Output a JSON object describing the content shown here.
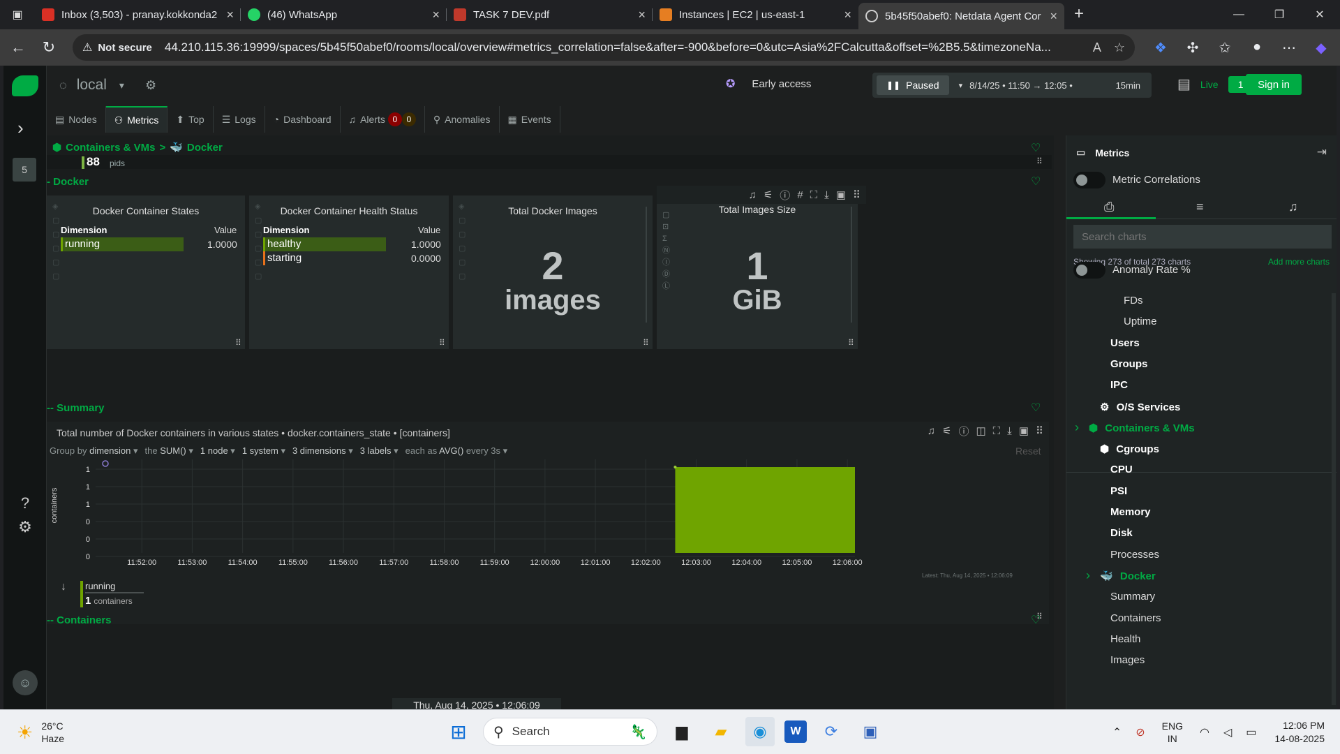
{
  "browser": {
    "tabs": [
      {
        "title": "Inbox (3,503) - pranay.kokkonda2",
        "color": "#d93025"
      },
      {
        "title": "(46) WhatsApp",
        "color": "#25d366"
      },
      {
        "title": "TASK 7 DEV.pdf",
        "color": "#c0392b"
      },
      {
        "title": "Instances | EC2 | us-east-1",
        "color": "#e67e22"
      },
      {
        "title": "5b45f50abef0: Netdata Agent Cor",
        "color": "#cfcfcf"
      }
    ],
    "not_secure": "Not secure",
    "url": "44.210.115.36:19999/spaces/5b45f50abef0/rooms/local/overview#metrics_correlation=false&after=-900&before=0&utc=Asia%2FCalcutta&offset=%2B5.5&timezoneNa..."
  },
  "netdata": {
    "room_name": "local",
    "space_badge": "5",
    "early_access": "Early access",
    "paused_label": "Paused",
    "time_range": "8/14/25 • 11:50 → 12:05 •",
    "duration": "15min",
    "live_label": "Live",
    "live_count": "1",
    "sign_in": "Sign in",
    "tabs": [
      {
        "label": "Nodes",
        "icon": "▤"
      },
      {
        "label": "Metrics",
        "icon": "⚇"
      },
      {
        "label": "Top",
        "icon": "⬆"
      },
      {
        "label": "Logs",
        "icon": "☰"
      },
      {
        "label": "Dashboard",
        "icon": "◔"
      },
      {
        "label": "Alerts",
        "icon": "🔔"
      },
      {
        "label": "Anomalies",
        "icon": "⚲"
      },
      {
        "label": "Events",
        "icon": "▦"
      }
    ],
    "alerts_critical": "0",
    "alerts_warning": "0"
  },
  "main": {
    "breadcrumb": {
      "root": "Containers & VMs",
      "sep": ">",
      "leaf": "Docker"
    },
    "pids_value": "88",
    "pids_unit": "pids",
    "section_docker": "- Docker",
    "section_summary": "-- Summary",
    "section_containers": "-- Containers",
    "cards": {
      "states": {
        "title": "Docker Container States",
        "dim_header": "Dimension",
        "val_header": "Value",
        "rows": [
          {
            "name": "running",
            "value": "1.0000",
            "color": "#6fa400"
          }
        ]
      },
      "health": {
        "title": "Docker Container Health Status",
        "dim_header": "Dimension",
        "val_header": "Value",
        "rows": [
          {
            "name": "healthy",
            "value": "1.0000",
            "color": "#6fa400"
          },
          {
            "name": "starting",
            "value": "0.0000",
            "color": "#e8711a"
          }
        ]
      },
      "images": {
        "title": "Total Docker Images",
        "value": "2",
        "unit": "images"
      },
      "size": {
        "title": "Total Images Size",
        "value": "1",
        "unit": "GiB"
      }
    },
    "summary_chart": {
      "title": "Total number of Docker containers in various states • docker.containers_state • [containers]",
      "group_by": "Group by",
      "group_by_value": "dimension",
      "agg_prefix": "the",
      "agg_value": "SUM()",
      "nodes": "1 node",
      "systems": "1 system",
      "dimensions": "3 dimensions",
      "labels": "3 labels",
      "each_as_prefix": "each as",
      "each_as_value": "AVG()",
      "every": "every 3s",
      "reset": "Reset",
      "legend_name": "running",
      "legend_value": "1",
      "legend_unit": "containers",
      "latest": "Latest: Thu, Aug 14, 2025 • 12:06:09"
    },
    "date_pill": "Thu, Aug 14, 2025 • 12:06:09"
  },
  "chart_data": {
    "type": "area",
    "title": "Total number of Docker containers in various states",
    "ylabel": "containers",
    "y_tick_labels": [
      "1",
      "1",
      "1",
      "0",
      "0",
      "0"
    ],
    "x": [
      "11:52:00",
      "11:53:00",
      "11:54:00",
      "11:55:00",
      "11:56:00",
      "11:57:00",
      "11:58:00",
      "11:59:00",
      "12:00:00",
      "12:01:00",
      "12:02:00",
      "12:03:00",
      "12:04:00",
      "12:05:00",
      "12:06:00"
    ],
    "x_domain": [
      "11:51:05",
      "12:06:09"
    ],
    "series": [
      {
        "name": "running",
        "color": "#6fa400",
        "start": "12:02:35",
        "end": "12:06:09",
        "value": 1
      }
    ],
    "ylim": [
      0,
      1
    ]
  },
  "right_panel": {
    "title": "Metrics",
    "metric_correlations": "Metric Correlations",
    "search_placeholder": "Search charts",
    "showing": "Showing 273 of total 273 charts",
    "add_more": "Add more charts",
    "anomaly_rate": "Anomaly Rate %",
    "tree": [
      {
        "label": "FDs",
        "style": "normal",
        "indent": 82
      },
      {
        "label": "Uptime",
        "style": "normal",
        "indent": 82
      },
      {
        "label": "Users",
        "style": "bold",
        "indent": 63
      },
      {
        "label": "Groups",
        "style": "bold",
        "indent": 63
      },
      {
        "label": "IPC",
        "style": "bold",
        "indent": 63
      },
      {
        "label": "O/S Services",
        "style": "bold",
        "indent": 48,
        "icon": "⚙"
      },
      {
        "label": "Containers & VMs",
        "style": "green",
        "indent": 32,
        "icon": "⬢",
        "chevron": "›"
      },
      {
        "label": "Cgroups",
        "style": "bold",
        "indent": 48,
        "icon": "⬢"
      },
      {
        "label": "CPU",
        "style": "bold",
        "indent": 63
      },
      {
        "label": "PSI",
        "style": "bold",
        "indent": 63
      },
      {
        "label": "Memory",
        "style": "bold",
        "indent": 63
      },
      {
        "label": "Disk",
        "style": "bold",
        "indent": 63
      },
      {
        "label": "Processes",
        "style": "normal",
        "indent": 63
      },
      {
        "label": "Docker",
        "style": "green",
        "indent": 48,
        "icon": "🐳",
        "chevron": "›"
      },
      {
        "label": "Summary",
        "style": "normal",
        "indent": 63
      },
      {
        "label": "Containers",
        "style": "normal",
        "indent": 63
      },
      {
        "label": "Health",
        "style": "normal",
        "indent": 63
      },
      {
        "label": "Images",
        "style": "normal",
        "indent": 63
      }
    ]
  },
  "taskbar": {
    "temp": "26°C",
    "condition": "Haze",
    "search": "Search",
    "lang1": "ENG",
    "lang2": "IN",
    "time": "12:06 PM",
    "date": "14-08-2025"
  }
}
